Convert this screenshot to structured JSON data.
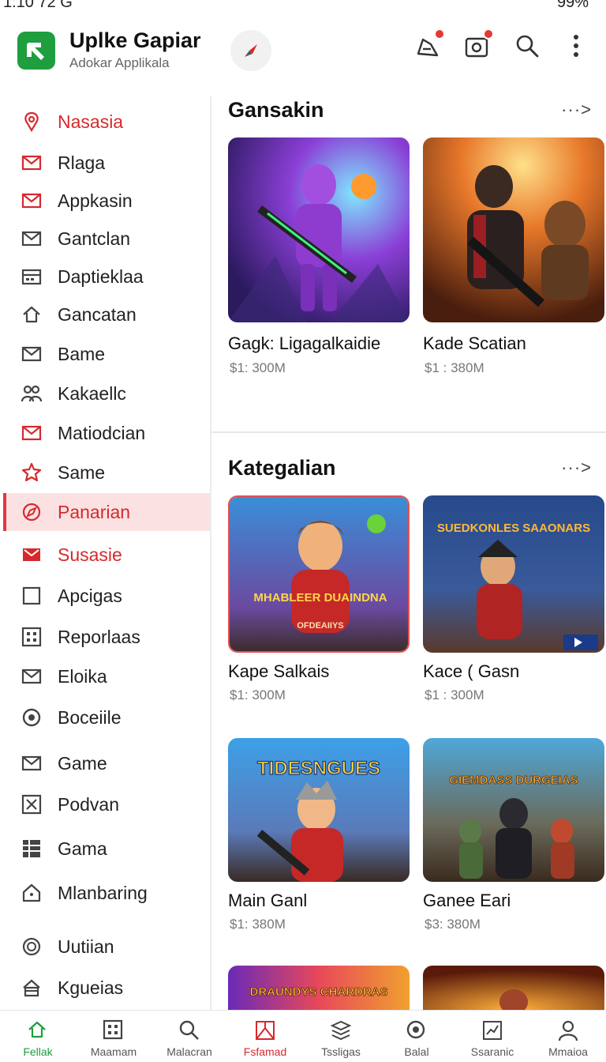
{
  "status_bar": {
    "time": "1:10 72 G",
    "battery": "99%"
  },
  "app": {
    "title": "Uplke Gapiar",
    "subtitle": "Adokar Applikala"
  },
  "colors": {
    "accent": "#d6292d",
    "brand": "#1e9e3e",
    "active_bg": "#fbe1e2"
  },
  "sidebar": {
    "items": [
      {
        "label": "Nasasia",
        "icon": "pin-icon",
        "style": "red"
      },
      {
        "label": "Rlaga",
        "icon": "mail-icon",
        "style": "redicon"
      },
      {
        "label": "Appkasin",
        "icon": "mail-check-icon",
        "style": "redicon"
      },
      {
        "label": "Gantclan",
        "icon": "mail-icon",
        "style": "plain"
      },
      {
        "label": "Daptieklaa",
        "icon": "calendar-icon",
        "style": "plain"
      },
      {
        "label": "Gancatan",
        "icon": "home-icon",
        "style": "plain"
      },
      {
        "label": "Bame",
        "icon": "mail-icon",
        "style": "plain"
      },
      {
        "label": "Kakaellc",
        "icon": "users-icon",
        "style": "plain"
      },
      {
        "label": "Matiodcian",
        "icon": "mail-icon",
        "style": "redicon"
      },
      {
        "label": "Same",
        "icon": "star-icon",
        "style": "redicon"
      },
      {
        "label": "Panarian",
        "icon": "compass-icon",
        "style": "active"
      },
      {
        "label": "Susasie",
        "icon": "mail-alert-icon",
        "style": "red"
      },
      {
        "label": "Apcigas",
        "icon": "square-icon",
        "style": "plain"
      },
      {
        "label": "Reporlaas",
        "icon": "grid-icon",
        "style": "plain"
      },
      {
        "label": "Eloika",
        "icon": "mail-icon",
        "style": "plain"
      },
      {
        "label": "Boceiile",
        "icon": "target-icon",
        "style": "plain"
      },
      {
        "label": "Game",
        "icon": "mail-icon",
        "style": "plain"
      },
      {
        "label": "Podvan",
        "icon": "box-x-icon",
        "style": "plain"
      },
      {
        "label": "Gama",
        "icon": "table-icon",
        "style": "plain"
      },
      {
        "label": "Mlanbaring",
        "icon": "house-icon",
        "style": "plain"
      },
      {
        "label": "Uutiian",
        "icon": "clock-icon",
        "style": "plain"
      },
      {
        "label": "Kgueias",
        "icon": "lock-icon",
        "style": "plain"
      }
    ]
  },
  "sections": [
    {
      "title": "Gansakin",
      "more": "···>",
      "cards": [
        {
          "name": "Gagk: Ligagalkaidie",
          "price": "$1: 300M"
        },
        {
          "name": "Kade Scatian",
          "price": "$1 : 380M"
        }
      ]
    },
    {
      "title": "Kategalian",
      "more": "···>",
      "cards": [
        {
          "name": "Kape Salkais",
          "price": "$1: 300M",
          "art_text": "MHABLEER DUAINDNA",
          "art_sub": "OFDEAIIYS"
        },
        {
          "name": "Kace ( Gasn",
          "price": "$1 : 300M",
          "art_text": "SUEDKONLES SAAONARS"
        },
        {
          "name": "Main Ganl",
          "price": "$1: 380M",
          "art_text": "TIDESNGUES"
        },
        {
          "name": "Ganee Eari",
          "price": "$3: 380M",
          "art_text": "GIEMDASS DURGEIAS"
        },
        {
          "name": "",
          "price": "",
          "art_text": "DRAUNDYS CHARDRAS"
        },
        {
          "name": "",
          "price": "",
          "art_text": ""
        }
      ]
    }
  ],
  "bottom_nav": [
    {
      "label": "Fellak",
      "icon": "home-icon",
      "state": "home"
    },
    {
      "label": "Maamam",
      "icon": "grid-icon",
      "state": ""
    },
    {
      "label": "Malacran",
      "icon": "search-icon",
      "state": ""
    },
    {
      "label": "Fsfamad",
      "icon": "gift-icon",
      "state": "active"
    },
    {
      "label": "Tssligas",
      "icon": "layers-icon",
      "state": ""
    },
    {
      "label": "Balal",
      "icon": "target-icon",
      "state": ""
    },
    {
      "label": "Ssaranic",
      "icon": "chart-icon",
      "state": ""
    },
    {
      "label": "Mmaioa",
      "icon": "person-icon",
      "state": ""
    }
  ]
}
